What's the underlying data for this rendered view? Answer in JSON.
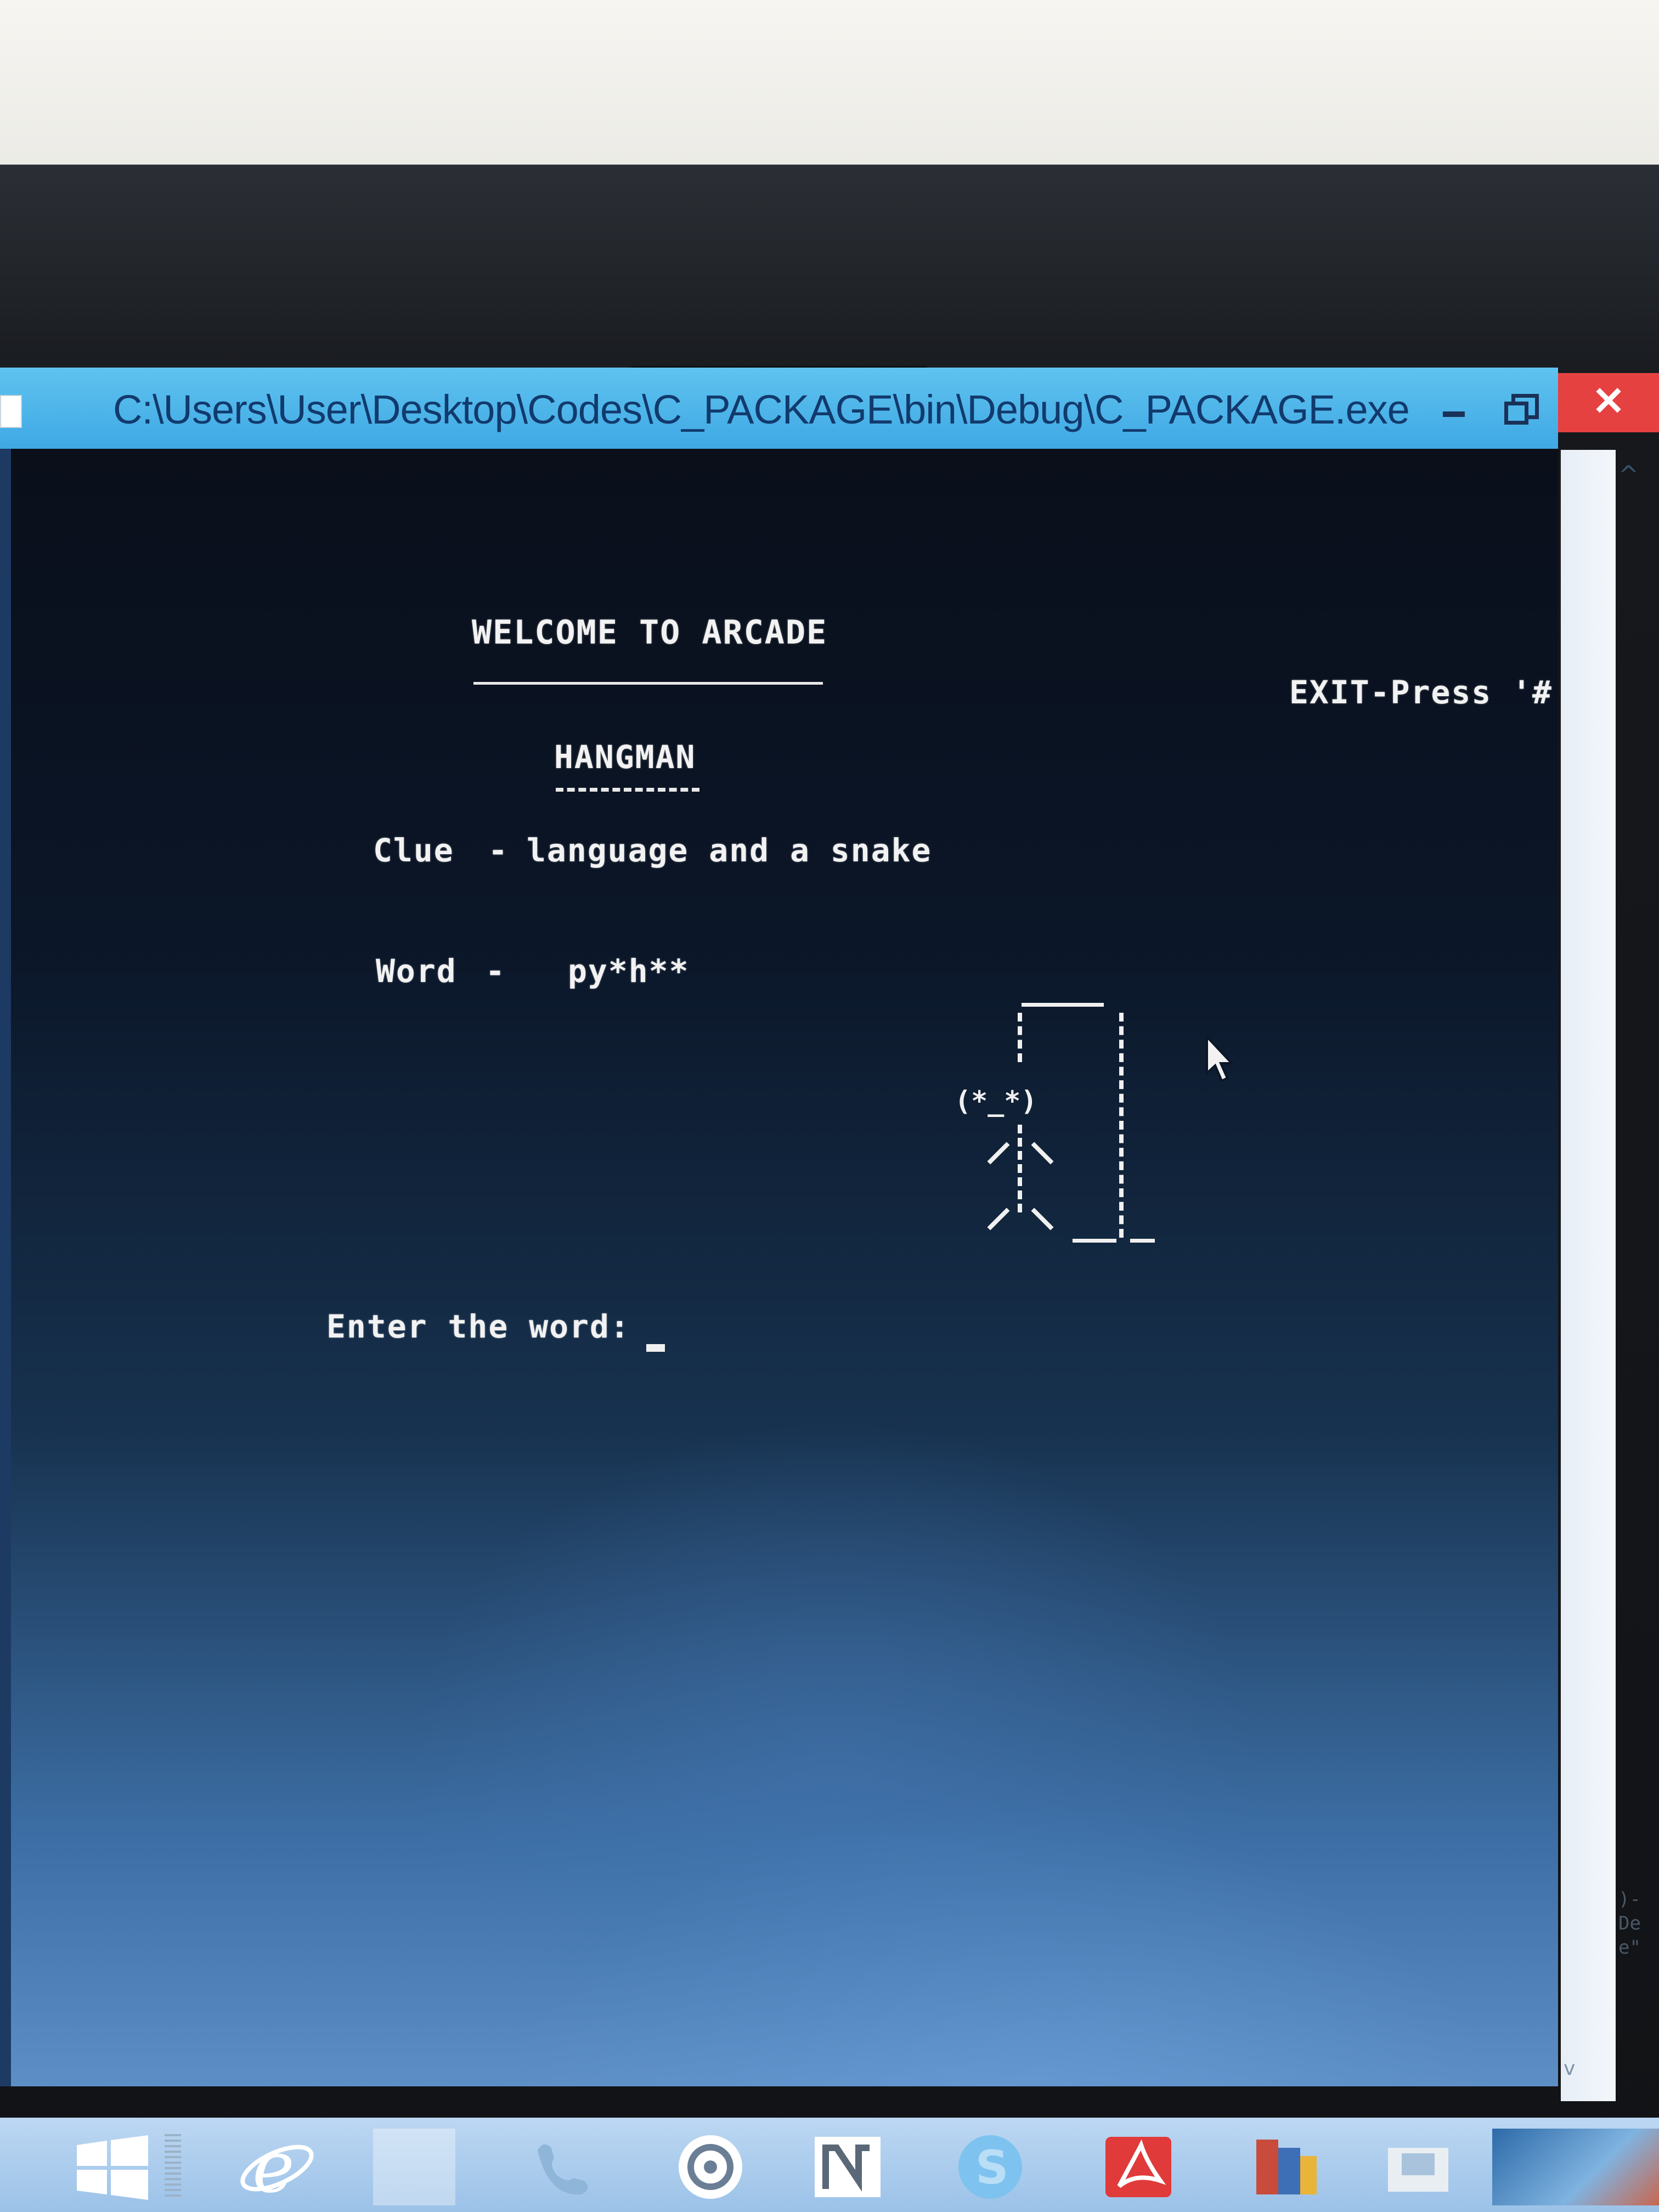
{
  "window": {
    "title": "C:\\Users\\User\\Desktop\\Codes\\C_PACKAGE\\bin\\Debug\\C_PACKAGE.exe",
    "close_glyph": "✕",
    "accent_color": "#3fa8e4",
    "close_color": "#e64141"
  },
  "console": {
    "welcome": "WELCOME TO ARCADE",
    "exit_hint": "EXIT-Press '#'",
    "game_title": "HANGMAN",
    "clue_label": "Clue",
    "clue_dash": "-",
    "clue_text": "language and a snake",
    "word_label": "Word",
    "word_dash": "-",
    "word_masked": "py*h**",
    "prompt": "Enter the word:",
    "face": "(*_*)"
  },
  "scrollbar": {
    "up_glyph": "^",
    "down_glyph": "v"
  },
  "side_peek": {
    "lines": [
      ")-",
      "De",
      "e\""
    ]
  },
  "taskbar": {
    "icons": [
      "windows-logo-icon",
      "internet-explorer-icon",
      "blank-app-icon",
      "phone-icon",
      "audio-player-icon",
      "app-n-icon",
      "skype-icon",
      "acrobat-icon",
      "office-icon",
      "folder-icon",
      "photo-icon"
    ]
  }
}
